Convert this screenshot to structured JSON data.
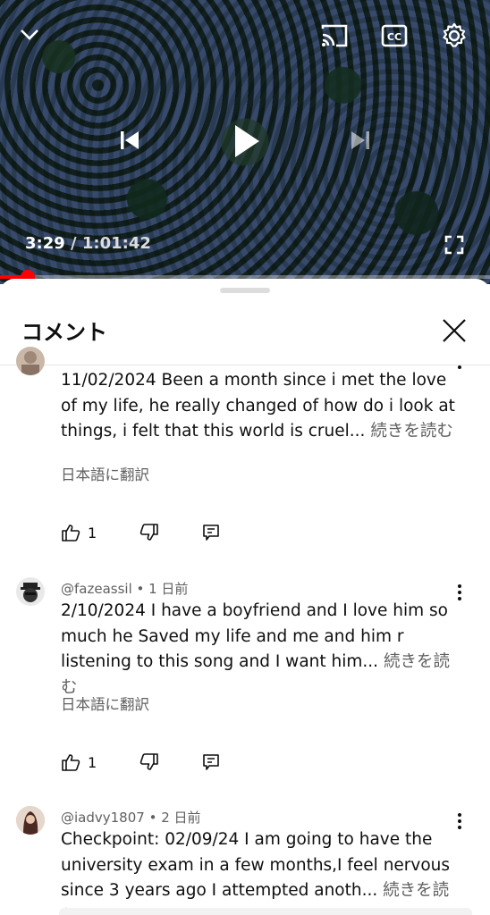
{
  "player": {
    "current_time": "3:29",
    "separator": " / ",
    "duration": "1:01:42",
    "progress_fraction": 0.057
  },
  "sheet": {
    "title": "コメント"
  },
  "comments": [
    {
      "author": "",
      "time_ago": "",
      "text": "11/02/2024 Been a month since i met the love of my life, he really changed of how do i look at things, i felt that this world is cruel...",
      "read_more": "続きを読む",
      "translate": "日本語に翻訳",
      "likes": "1"
    },
    {
      "author": "@fazeassil",
      "separator": " • ",
      "time_ago": "1 日前",
      "text": "2/10/2024 I have a boyfriend and I love him so much he Saved my life  and me and him r listening to this song and I want him...",
      "read_more": "続きを読む",
      "translate": "日本語に翻訳",
      "likes": "1"
    },
    {
      "author": "@iadvy1807",
      "separator": " • ",
      "time_ago": "2 日前",
      "text": "Checkpoint: 02/09/24 I am going to have the university exam in a few months,I feel nervous since 3 years ago I attempted anoth...",
      "read_more": "続きを読む"
    }
  ],
  "icons": {
    "collapse": "chevron-down-icon",
    "cast": "cast-icon",
    "captions": "cc-icon",
    "settings": "gear-icon",
    "prev": "skip-previous-icon",
    "play": "play-icon",
    "next": "skip-next-icon",
    "fullscreen": "fullscreen-icon",
    "close": "close-icon",
    "more": "more-vert-icon",
    "like": "thumb-up-icon",
    "dislike": "thumb-down-icon",
    "reply": "reply-icon"
  },
  "colors": {
    "accent": "#ff0000",
    "secondary_text": "#606060"
  }
}
